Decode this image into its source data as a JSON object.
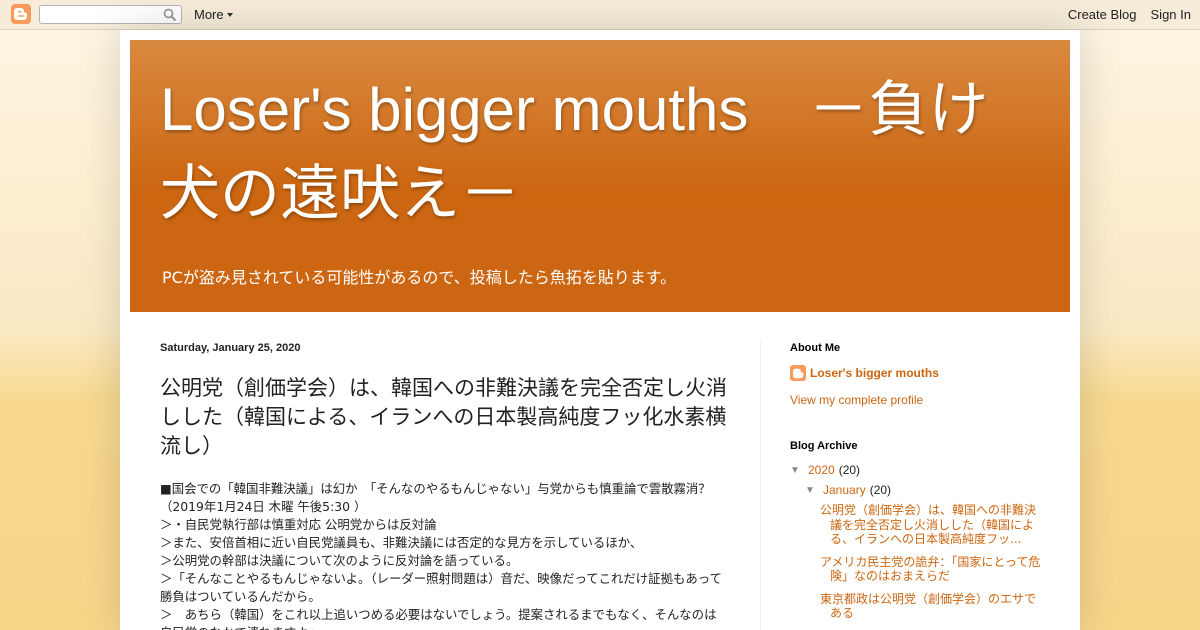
{
  "navbar": {
    "more_label": "More",
    "create_blog_label": "Create Blog",
    "sign_in_label": "Sign In"
  },
  "header": {
    "title": "Loser's bigger mouths　－負け犬の遠吠え－",
    "description": "PCが盗み見されている可能性があるので、投稿したら魚拓を貼ります。"
  },
  "post": {
    "date": "Saturday, January 25, 2020",
    "title": "公明党（創価学会）は、韓国への非難決議を完全否定し火消しした（韓国による、イランへの日本製高純度フッ化水素横流し）",
    "body_lines": [
      "■国会での「韓国非難決議」は幻か　「そんなのやるもんじゃない」与党からも慎重論で雲散霧消？（2019年1月24日 木曜 午後5:30 ）",
      "＞・自民党執行部は慎重対応  公明党からは反対論",
      "＞また、安倍首相に近い自民党議員も、非難決議には否定的な見方を示しているほか、",
      "＞公明党の幹部は決議について次のように反対論を語っている。",
      "＞「そんなことやるもんじゃないよ。（レーダー照射問題は）音だ、映像だってこれだけ証拠もあって勝負はついているんだから。",
      "＞　あちら（韓国）をこれ以上追いつめる必要はないでしょう。提案されるまでもなく、そんなのは自民党のなかで潰れますよ」"
    ]
  },
  "sidebar": {
    "about_title": "About Me",
    "profile_name": "Loser's bigger mouths",
    "profile_link": "View my complete profile",
    "archive_title": "Blog Archive",
    "year": {
      "label": "2020",
      "count": "(20)"
    },
    "month": {
      "label": "January",
      "count": "(20)"
    },
    "posts": [
      "公明党（創価学会）は、韓国への非難決議を完全否定し火消しした（韓国による、イランへの日本製高純度フッ...",
      "アメリカ民主党の詭弁：「国家にとって危険」なのはおまえらだ",
      "東京都政は公明党（創価学会）のエサである"
    ]
  },
  "colors": {
    "accent": "#cc6611",
    "header_top": "#d98940",
    "header_bottom": "#cc6613",
    "background": "#f7d68a"
  }
}
